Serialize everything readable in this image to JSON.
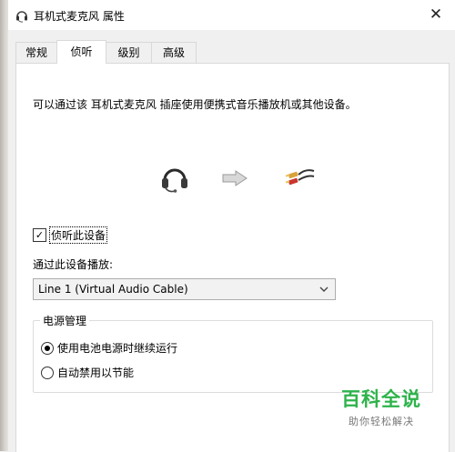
{
  "window": {
    "title": "耳机式麦克风 属性",
    "close_icon": "close-icon"
  },
  "tabs": [
    {
      "label": "常规",
      "active": false
    },
    {
      "label": "侦听",
      "active": true
    },
    {
      "label": "级别",
      "active": false
    },
    {
      "label": "高级",
      "active": false
    }
  ],
  "listen": {
    "description": "可以通过该 耳机式麦克风 插座使用便携式音乐播放机或其他设备。",
    "icons": [
      "headset-icon",
      "arrow-right-icon",
      "audio-cable-icon"
    ],
    "checkbox_label": "侦听此设备",
    "checkbox_checked": true,
    "playback_label": "通过此设备播放:",
    "playback_device": "Line 1 (Virtual Audio Cable)"
  },
  "power": {
    "label": "电源管理",
    "options": [
      {
        "label": "使用电池电源时继续运行",
        "selected": true
      },
      {
        "label": "自动禁用以节能",
        "selected": false
      }
    ]
  },
  "watermark": {
    "main": "百科全说",
    "sub": "助你轻松解决"
  }
}
